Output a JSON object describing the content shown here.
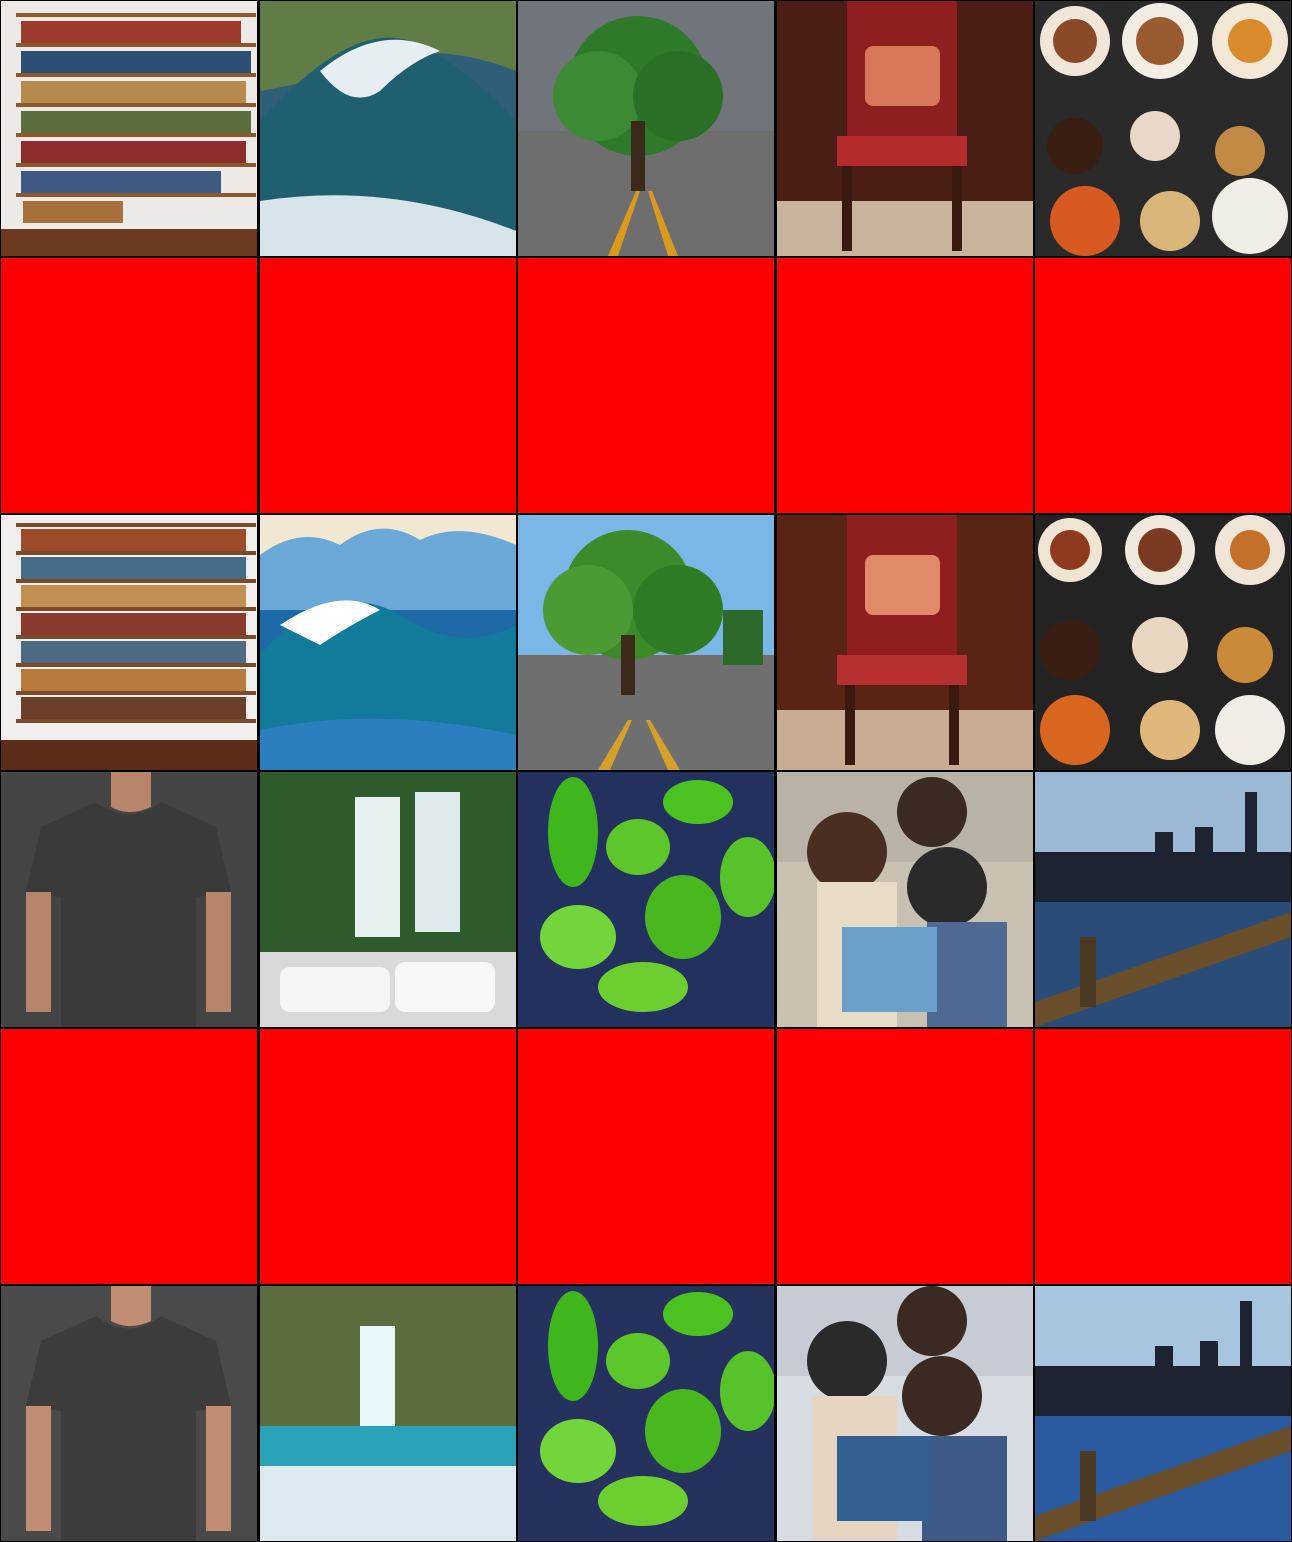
{
  "grid": {
    "columns": 5,
    "rows": 6,
    "cells": [
      {
        "row": 1,
        "col": 1,
        "subject": "bookshelf-photo"
      },
      {
        "row": 1,
        "col": 2,
        "subject": "ocean-wave-photo"
      },
      {
        "row": 1,
        "col": 3,
        "subject": "tree-on-road-photo"
      },
      {
        "row": 1,
        "col": 4,
        "subject": "red-armchair-photo"
      },
      {
        "row": 1,
        "col": 5,
        "subject": "food-spread-photo"
      },
      {
        "row": 2,
        "col": 1,
        "subject": "red-mask"
      },
      {
        "row": 2,
        "col": 2,
        "subject": "red-mask"
      },
      {
        "row": 2,
        "col": 3,
        "subject": "red-mask"
      },
      {
        "row": 2,
        "col": 4,
        "subject": "red-mask"
      },
      {
        "row": 2,
        "col": 5,
        "subject": "red-mask"
      },
      {
        "row": 3,
        "col": 1,
        "subject": "bookshelf-illustration"
      },
      {
        "row": 3,
        "col": 2,
        "subject": "ocean-wave-illustration"
      },
      {
        "row": 3,
        "col": 3,
        "subject": "tree-on-road-illustration"
      },
      {
        "row": 3,
        "col": 4,
        "subject": "red-armchair-illustration"
      },
      {
        "row": 3,
        "col": 5,
        "subject": "food-spread-illustration"
      },
      {
        "row": 4,
        "col": 1,
        "subject": "gray-tshirt-photo"
      },
      {
        "row": 4,
        "col": 2,
        "subject": "waterfall-photo"
      },
      {
        "row": 4,
        "col": 3,
        "subject": "green-peppers-photo"
      },
      {
        "row": 4,
        "col": 4,
        "subject": "people-with-books-photo"
      },
      {
        "row": 4,
        "col": 5,
        "subject": "city-bridge-photo"
      },
      {
        "row": 5,
        "col": 1,
        "subject": "red-mask"
      },
      {
        "row": 5,
        "col": 2,
        "subject": "red-mask"
      },
      {
        "row": 5,
        "col": 3,
        "subject": "red-mask"
      },
      {
        "row": 5,
        "col": 4,
        "subject": "red-mask"
      },
      {
        "row": 5,
        "col": 5,
        "subject": "red-mask"
      },
      {
        "row": 6,
        "col": 1,
        "subject": "gray-tshirt-illustration"
      },
      {
        "row": 6,
        "col": 2,
        "subject": "waterfall-illustration"
      },
      {
        "row": 6,
        "col": 3,
        "subject": "green-peppers-illustration"
      },
      {
        "row": 6,
        "col": 4,
        "subject": "people-with-books-illustration"
      },
      {
        "row": 6,
        "col": 5,
        "subject": "city-bridge-illustration"
      }
    ]
  },
  "colors": {
    "mask": "#ff0000",
    "background": "#000000"
  }
}
